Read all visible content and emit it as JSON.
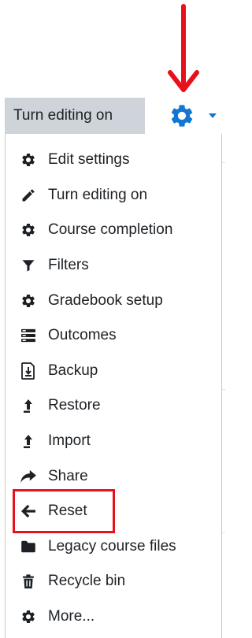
{
  "header": {
    "turn_editing_label": "Turn editing on",
    "gear_icon": "gear-icon",
    "caret_icon": "caret-down-icon",
    "accent_color": "#1177d1"
  },
  "annotation": {
    "arrow_color": "#e8101a",
    "highlight_color": "#e8101a"
  },
  "menu": {
    "items": [
      {
        "label": "Edit settings",
        "icon": "cog-icon"
      },
      {
        "label": "Turn editing on",
        "icon": "pencil-icon"
      },
      {
        "label": "Course completion",
        "icon": "cog-icon"
      },
      {
        "label": "Filters",
        "icon": "filter-icon"
      },
      {
        "label": "Gradebook setup",
        "icon": "cog-icon"
      },
      {
        "label": "Outcomes",
        "icon": "outcomes-icon"
      },
      {
        "label": "Backup",
        "icon": "backup-file-icon"
      },
      {
        "label": "Restore",
        "icon": "upload-arrow-icon"
      },
      {
        "label": "Import",
        "icon": "upload-arrow-icon"
      },
      {
        "label": "Share",
        "icon": "share-icon"
      },
      {
        "label": "Reset",
        "icon": "arrow-left-icon"
      },
      {
        "label": "Legacy course files",
        "icon": "folder-icon"
      },
      {
        "label": "Recycle bin",
        "icon": "trash-icon"
      },
      {
        "label": "More...",
        "icon": "cog-icon"
      }
    ]
  }
}
